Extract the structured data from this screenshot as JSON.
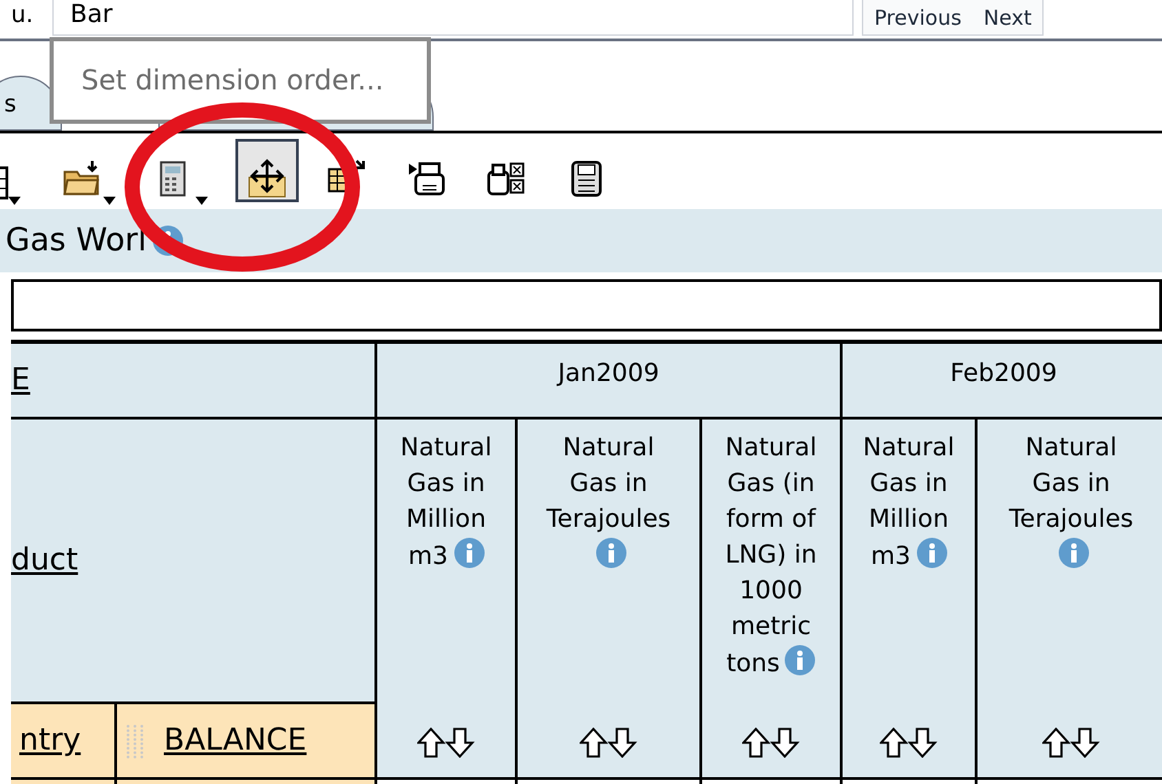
{
  "top_bar": {
    "label": "u.",
    "field_value": "Bar",
    "buttons": [
      "Previous",
      "Next"
    ]
  },
  "tooltip": "Set dimension order...",
  "tabs": [
    {
      "label": "s"
    }
  ],
  "toolbar": [
    {
      "kind": "table",
      "dropdown": true,
      "pressed": false
    },
    {
      "kind": "folder",
      "dropdown": true,
      "pressed": false
    },
    {
      "kind": "calculator",
      "dropdown": true,
      "pressed": false
    },
    {
      "kind": "move",
      "dropdown": false,
      "pressed": true
    },
    {
      "kind": "layout",
      "dropdown": false,
      "pressed": false
    },
    {
      "kind": "print",
      "dropdown": false,
      "pressed": false
    },
    {
      "kind": "print-config",
      "dropdown": false,
      "pressed": false
    },
    {
      "kind": "save",
      "dropdown": false,
      "pressed": false
    }
  ],
  "title": {
    "text": "Gas Worl",
    "info": true
  },
  "table": {
    "corner_top": "E",
    "corner_middle": "duct",
    "row_dimensions": [
      "ntry",
      "BALANCE"
    ],
    "column_groups": [
      {
        "label": "Jan2009",
        "measures": [
          {
            "label": "Natural Gas in Million m3",
            "info": true
          },
          {
            "label": "Natural Gas in Terajoules",
            "info": true
          },
          {
            "label": "Natural Gas (in form of LNG) in 1000 metric tons",
            "info": true
          }
        ]
      },
      {
        "label": "Feb2009",
        "measures": [
          {
            "label": "Natural Gas in Million m3",
            "info": true
          },
          {
            "label": "Natural Gas in Terajoules",
            "info": true
          }
        ]
      }
    ]
  }
}
